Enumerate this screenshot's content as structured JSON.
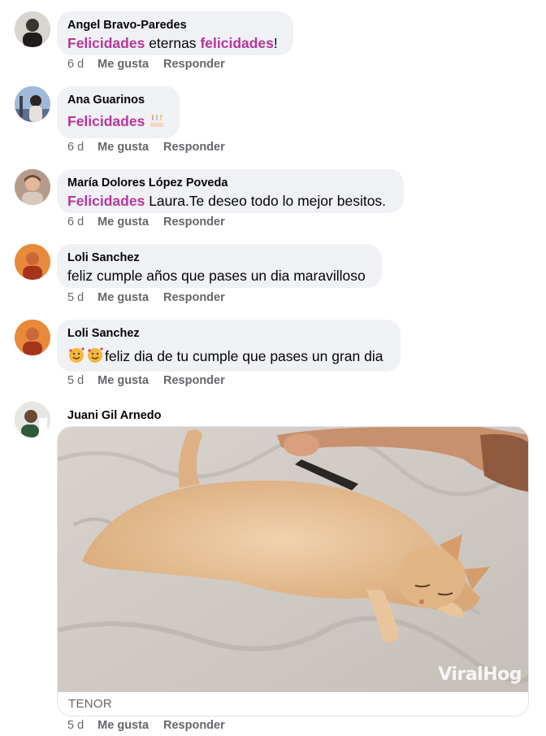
{
  "comments": [
    {
      "author": "Angel Bravo-Paredes",
      "text_parts": [
        "Felicidades",
        " eternas ",
        "felicidades",
        "!"
      ],
      "time": "6 d",
      "like": "Me gusta",
      "reply": "Responder"
    },
    {
      "author": "Ana Guarinos",
      "text_parts": [
        "Felicidades",
        " "
      ],
      "emoji": "cake-emoji",
      "time": "6 d",
      "like": "Me gusta",
      "reply": "Responder"
    },
    {
      "author": "María Dolores López Poveda",
      "text_parts": [
        "Felicidades",
        " Laura.Te deseo todo lo mejor besitos."
      ],
      "time": "6 d",
      "like": "Me gusta",
      "reply": "Responder"
    },
    {
      "author": "Loli Sanchez",
      "text": "feliz cumple años que pases un dia maravilloso",
      "time": "5 d",
      "like": "Me gusta",
      "reply": "Responder"
    },
    {
      "author": "Loli Sanchez",
      "emoji": "smiling-face-with-hearts-emoji",
      "text": "feliz dia de tu cumple que pases un gran dia",
      "time": "5 d",
      "like": "Me gusta",
      "reply": "Responder"
    },
    {
      "author": "Juani Gil Arnedo",
      "gif": {
        "watermark": "ViralHog",
        "source": "TENOR",
        "subject": "cat-being-brushed-gif"
      },
      "time": "5 d",
      "like": "Me gusta",
      "reply": "Responder"
    }
  ],
  "colors": {
    "highlight": "#b7369a",
    "bubble": "#eff1f4",
    "meta": "#65676b"
  }
}
